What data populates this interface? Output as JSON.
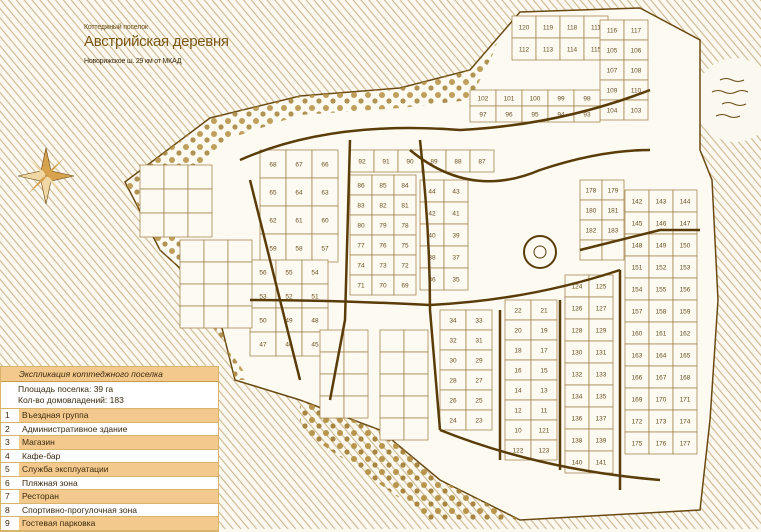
{
  "map": {
    "subtitle": "Коттеджный поселок",
    "title": "Австрийская деревня",
    "note": "Новорижское ш. 29 км от МКАД",
    "colors": {
      "road": "#5a3c08",
      "plot_fill": "#fdfaf2",
      "plot_stroke": "#9a7a40",
      "tree": "#b8954a",
      "hatch": "#cdb98f",
      "accent": "#f3c98d"
    },
    "plots": [
      "120",
      "119",
      "118",
      "111",
      "112",
      "113",
      "114",
      "115",
      "116",
      "117",
      "105",
      "106",
      "107",
      "108",
      "109",
      "110",
      "104",
      "103",
      "102",
      "101",
      "100",
      "99",
      "98",
      "97",
      "96",
      "95",
      "94",
      "93",
      "92",
      "91",
      "90",
      "89",
      "88",
      "87",
      "86",
      "85",
      "84",
      "83",
      "82",
      "81",
      "80",
      "79",
      "78",
      "77",
      "76",
      "75",
      "74",
      "73",
      "72",
      "71",
      "70",
      "69",
      "68",
      "67",
      "66",
      "65",
      "64",
      "63",
      "62",
      "61",
      "60",
      "59",
      "58",
      "57",
      "56",
      "55",
      "54",
      "53",
      "52",
      "51",
      "50",
      "49",
      "48",
      "47",
      "46",
      "45",
      "44",
      "43",
      "42",
      "41",
      "40",
      "39",
      "38",
      "37",
      "36",
      "35",
      "34",
      "33",
      "32",
      "31",
      "30",
      "29",
      "28",
      "27",
      "26",
      "25",
      "24",
      "23",
      "22",
      "21",
      "20",
      "19",
      "18",
      "17",
      "16",
      "15",
      "14",
      "13",
      "12",
      "11",
      "10",
      "121",
      "122",
      "123",
      "124",
      "125",
      "126",
      "127",
      "128",
      "129",
      "130",
      "131",
      "132",
      "133",
      "134",
      "135",
      "136",
      "137",
      "138",
      "139",
      "140",
      "141",
      "142",
      "143",
      "144",
      "145",
      "146",
      "147",
      "148",
      "149",
      "150",
      "151",
      "152",
      "153",
      "154",
      "155",
      "156",
      "157",
      "158",
      "159",
      "160",
      "161",
      "162",
      "163",
      "164",
      "165",
      "166",
      "167",
      "168",
      "169",
      "170",
      "171",
      "172",
      "173",
      "174",
      "175",
      "176",
      "177",
      "178",
      "179",
      "180",
      "181",
      "182",
      "183"
    ]
  },
  "legend": {
    "header": "Экспликация коттеджного поселка",
    "area": "Площадь поселка: 39 га",
    "houses": "Кол-во домовладений: 183",
    "items": [
      {
        "num": "1",
        "label": "Въездная группа"
      },
      {
        "num": "2",
        "label": "Административное здание"
      },
      {
        "num": "3",
        "label": "Магазин"
      },
      {
        "num": "4",
        "label": "Кафе-бар"
      },
      {
        "num": "5",
        "label": "Служба эксплуатации"
      },
      {
        "num": "6",
        "label": "Пляжная зона"
      },
      {
        "num": "7",
        "label": "Ресторан"
      },
      {
        "num": "8",
        "label": "Спортивно-прогулочная зона"
      },
      {
        "num": "9",
        "label": "Гостевая парковка"
      }
    ]
  }
}
